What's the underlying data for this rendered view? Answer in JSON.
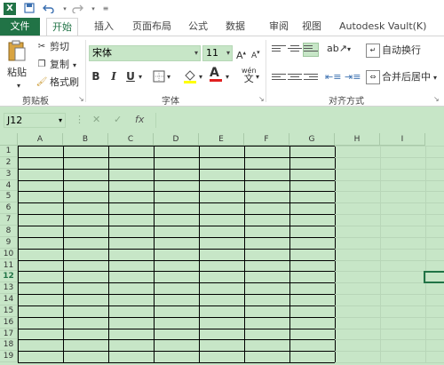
{
  "quick_access": {
    "logo": "X",
    "save_icon": "save-icon",
    "undo_icon": "undo-icon",
    "redo_icon": "redo-icon"
  },
  "tabs": [
    "文件",
    "开始",
    "插入",
    "页面布局",
    "公式",
    "数据",
    "审阅",
    "视图",
    "Autodesk Vault(K)"
  ],
  "active_tab": "开始",
  "clipboard": {
    "paste": "粘贴",
    "cut": "剪切",
    "copy": "复制",
    "format_painter": "格式刷",
    "group_label": "剪贴板"
  },
  "font": {
    "name": "宋体",
    "size": "11",
    "bold": "B",
    "italic": "I",
    "underline": "U",
    "group_label": "字体",
    "wen": "wén"
  },
  "alignment": {
    "wrap_text": "自动换行",
    "merge_center": "合并后居中",
    "group_label": "对齐方式"
  },
  "formula_bar": {
    "name_box": "J12",
    "cancel": "✕",
    "enter": "✓",
    "fx": "fx",
    "value": ""
  },
  "columns": [
    "A",
    "B",
    "C",
    "D",
    "E",
    "F",
    "G",
    "H",
    "I"
  ],
  "rows": [
    "1",
    "2",
    "3",
    "4",
    "5",
    "6",
    "7",
    "8",
    "9",
    "10",
    "11",
    "12",
    "13",
    "14",
    "15",
    "16",
    "17",
    "18",
    "19"
  ],
  "active_row": "12",
  "colors": {
    "accent": "#217346",
    "sheet_bg": "#c7e6c7"
  }
}
